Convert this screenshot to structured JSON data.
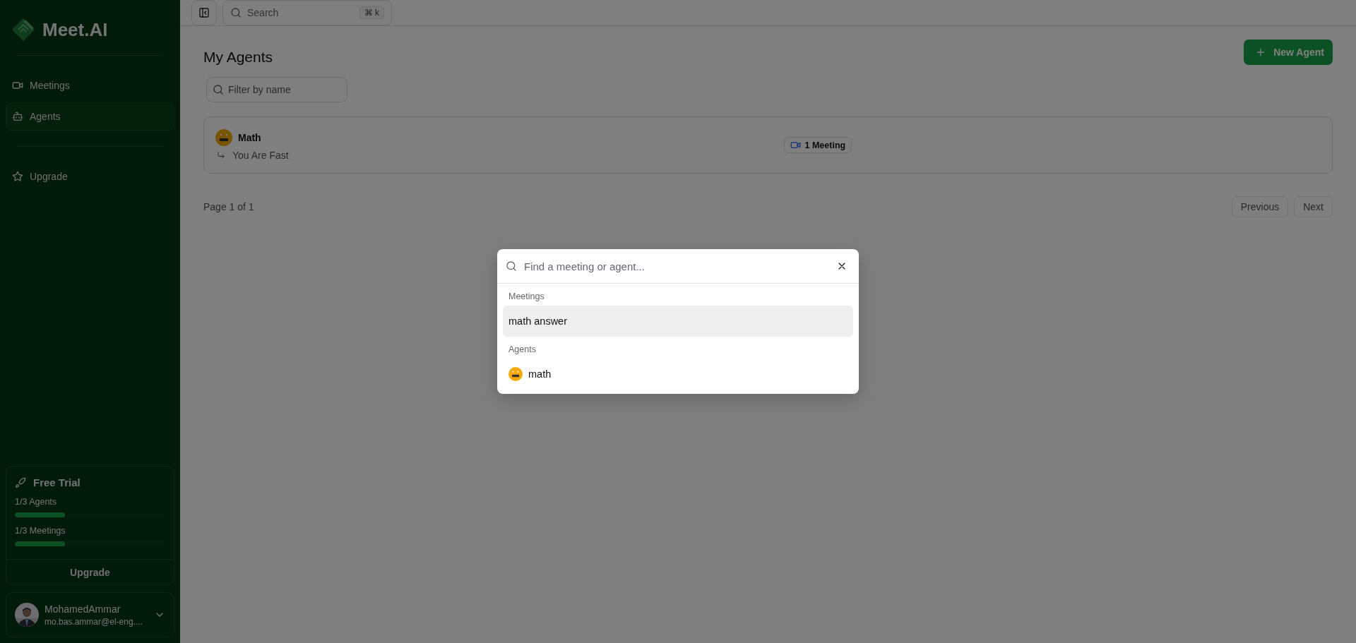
{
  "sidebar": {
    "logo": "Meet.AI",
    "nav": [
      {
        "label": "Meetings",
        "kind": "video",
        "selected": false
      },
      {
        "label": "Agents",
        "kind": "bot",
        "selected": true
      }
    ],
    "secondary": [
      {
        "label": "Upgrade",
        "kind": "star",
        "selected": false
      }
    ],
    "trial": {
      "title": "Free Trial",
      "meters": [
        {
          "label": "1/3 Agents",
          "level": 0.333
        },
        {
          "label": "1/3 Meetings",
          "level": 0.333
        }
      ],
      "button": "Upgrade"
    },
    "user": {
      "name": "MohamedAmmar",
      "email": "mo.bas.ammar@el-eng...."
    }
  },
  "topbar": {
    "search": {
      "placeholder": "Search",
      "shortcut": "⌘ k"
    }
  },
  "page": {
    "title": "My Agents",
    "new_button": "New Agent",
    "filter": {
      "placeholder": "Filter by name"
    },
    "agents": [
      {
        "name": "Math",
        "instructions": "You Are Fast",
        "meetings": "1 Meeting"
      }
    ],
    "pagination": {
      "label": "Page 1 of 1",
      "buttons": [
        "Previous",
        "Next"
      ]
    }
  },
  "dialog": {
    "placeholder": "Find a meeting or agent...",
    "groups": [
      {
        "heading": "Meetings",
        "items": [
          {
            "label": "math answer",
            "kind": "meeting",
            "selected": true
          }
        ]
      },
      {
        "heading": "Agents",
        "items": [
          {
            "label": "math",
            "kind": "agent",
            "selected": false
          }
        ]
      }
    ]
  }
}
